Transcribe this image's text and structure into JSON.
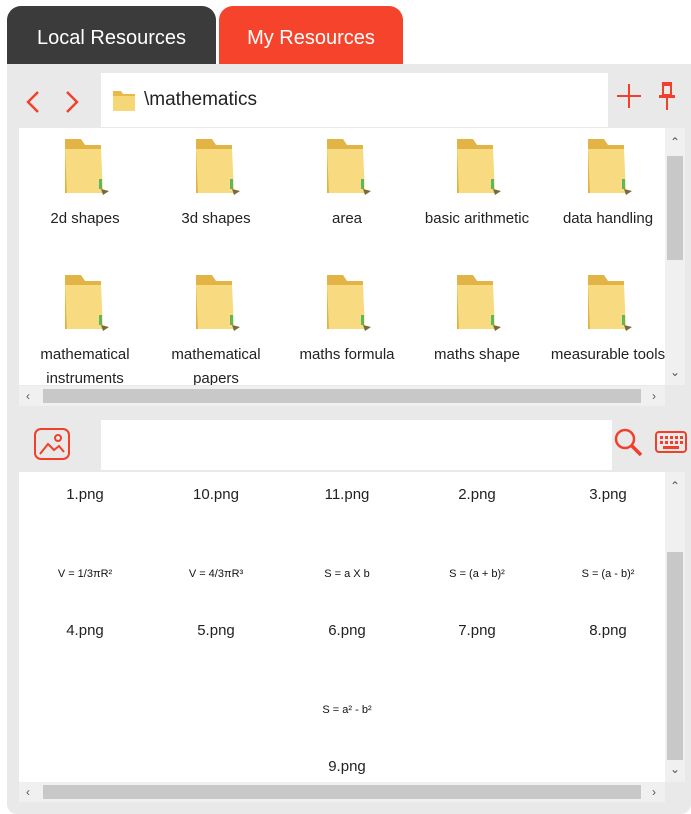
{
  "tabs": [
    {
      "label": "Local Resources",
      "active": false
    },
    {
      "label": "My Resources",
      "active": true
    }
  ],
  "nav": {
    "back_icon": "chevron-left-icon",
    "forward_icon": "chevron-right-icon"
  },
  "path": {
    "text": "\\mathematics",
    "icon": "folder-icon"
  },
  "folders": [
    {
      "label": "2d shapes"
    },
    {
      "label": "3d shapes"
    },
    {
      "label": "area"
    },
    {
      "label": "basic arithmetic"
    },
    {
      "label": "data handling"
    },
    {
      "label": "mathematical instruments"
    },
    {
      "label": "mathematical papers"
    },
    {
      "label": "maths formula"
    },
    {
      "label": "maths shape"
    },
    {
      "label": "measurable tools"
    }
  ],
  "images": [
    {
      "name": "1.png",
      "preview": ""
    },
    {
      "name": "10.png",
      "preview": ""
    },
    {
      "name": "11.png",
      "preview": ""
    },
    {
      "name": "2.png",
      "preview": ""
    },
    {
      "name": "3.png",
      "preview": ""
    },
    {
      "name": "4.png",
      "preview": "V = 1/3πR²"
    },
    {
      "name": "5.png",
      "preview": "V = 4/3πR³"
    },
    {
      "name": "6.png",
      "preview": "S = a X b"
    },
    {
      "name": "7.png",
      "preview": "S = (a + b)²"
    },
    {
      "name": "8.png",
      "preview": "S = (a - b)²"
    },
    {
      "name": "9.png",
      "preview": "S = a² - b²"
    }
  ],
  "search": {
    "placeholder": ""
  },
  "colors": {
    "accent": "#f5442b",
    "tab_inactive": "#3b3b3b",
    "panel": "#e9e9e9",
    "folder": "#f3d06a"
  }
}
